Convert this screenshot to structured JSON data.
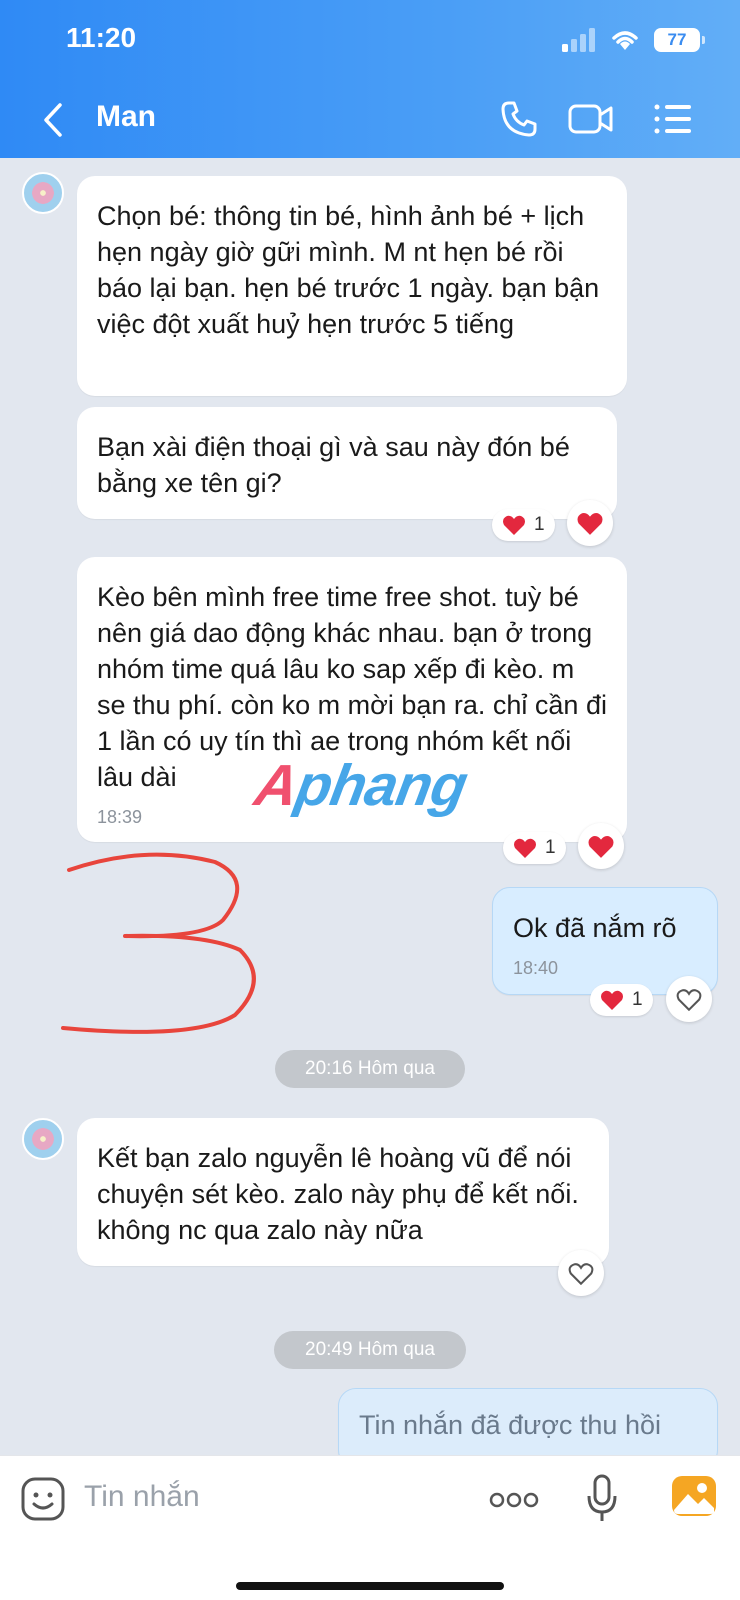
{
  "status_bar": {
    "time": "11:20",
    "battery": "77"
  },
  "header": {
    "title": "Man"
  },
  "messages": [
    {
      "text": "Chọn bé:  thông tin bé, hình ảnh bé + lịch hẹn ngày giờ gữi mình. M nt hẹn bé rồi báo lại bạn. hẹn bé trước 1 ngày. bạn bận việc đột xuất huỷ hẹn trước 5 tiếng"
    },
    {
      "text": "Bạn xài điện thoại  gì và sau này đón bé bằng xe tên gi?",
      "reaction_count": "1"
    },
    {
      "text": "Kèo bên mình free time free shot. tuỳ bé nên giá dao động khác nhau. bạn ở trong nhóm time quá lâu ko sap xếp đi kèo. m se thu phí. còn ko m mời bạn ra. chỉ cần đi 1 lần có uy tín thì ae trong nhóm kết nối lâu dài",
      "time": "18:39",
      "reaction_count": "1"
    },
    {
      "text": "Ok đã nắm rõ",
      "time": "18:40",
      "reaction_count": "1"
    },
    {
      "text": "Kết bạn zalo nguyễn lê hoàng vũ để nói chuyện sét kèo. zalo này phụ để kết nối. không nc qua zalo này nữa"
    },
    {
      "text": "Tin nhắn đã được thu hồi"
    }
  ],
  "dividers": [
    "20:16 Hôm qua",
    "20:49 Hôm qua"
  ],
  "watermark": {
    "part1": "A",
    "part2": "phang"
  },
  "annotation": {
    "mark": "3",
    "color": "#e8453c"
  },
  "input": {
    "placeholder": "Tin nhắn"
  },
  "colors": {
    "header": "#3a8ff5",
    "background": "#e2e7ef",
    "my_bubble": "#d8edff",
    "heart": "#e3283e"
  }
}
